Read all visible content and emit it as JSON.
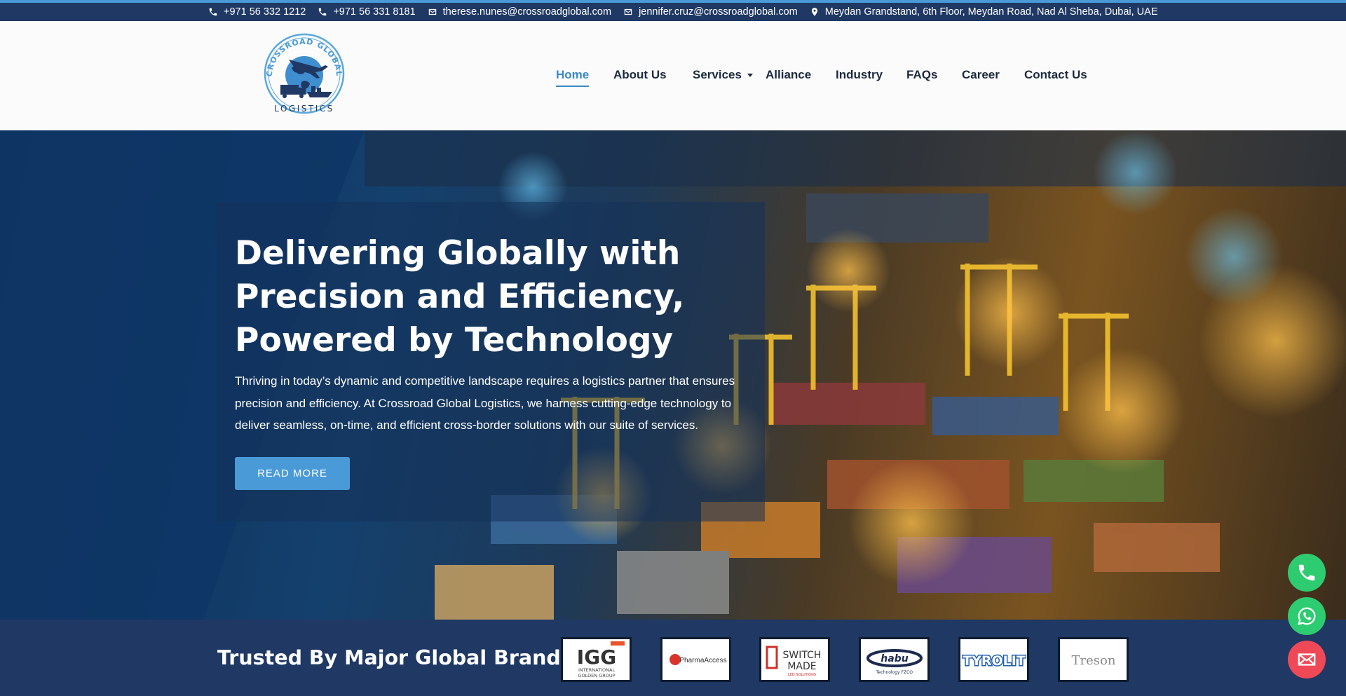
{
  "topbar": {
    "phone1": "+971 56 332 1212",
    "phone2": "+971 56 331 8181",
    "email1": "therese.nunes@crossroadglobal.com",
    "email2": "jennifer.cruz@crossroadglobal.com",
    "address": "Meydan Grandstand, 6th Floor, Meydan Road, Nad Al Sheba, Dubai, UAE"
  },
  "logo": {
    "arc_text": "CROSSROAD GLOBAL",
    "bottom_text": "LOGISTICS"
  },
  "nav": {
    "items": [
      {
        "label": "Home",
        "active": true
      },
      {
        "label": "About  Us"
      },
      {
        "label": "Services"
      },
      {
        "label": "Alliance"
      },
      {
        "label": "Industry"
      },
      {
        "label": "FAQs"
      },
      {
        "label": "Career"
      },
      {
        "label": "Contact  Us"
      }
    ]
  },
  "hero": {
    "title_line1": "Delivering Globally with",
    "title_line2": "Precision and Efficiency,",
    "title_line3": "Powered by Technology",
    "text": "Thriving in today’s dynamic and competitive landscape requires a logistics partner that ensures precision and efficiency. At Crossroad Global Logistics, we harness cutting-edge technology to deliver seamless, on-time, and efficient cross-border solutions with our suite of services.",
    "button": "READ MORE"
  },
  "brands": {
    "title": "Trusted By Major Global Brands",
    "logos": {
      "igg": "IGG",
      "igg_sub1": "INTERNATIONAL",
      "igg_sub2": "GOLDEN GROUP",
      "pharma": "PharmaAccess",
      "switch1": "SWITCH",
      "switch2": "MADE",
      "switch_sub": "LED SOLUTIONS",
      "habu": "habu",
      "habu_sub": "Technology FZCO",
      "tyrolit": "TYROLIT",
      "treson": "Treson"
    }
  },
  "colors": {
    "navy": "#1f3864",
    "accent": "#4a9ad8",
    "whatsapp": "#2ecc71",
    "mail": "#ef4957"
  },
  "icons": [
    "phone-icon",
    "mail-icon",
    "location-pin-icon",
    "whatsapp-icon",
    "envelope-icon"
  ]
}
